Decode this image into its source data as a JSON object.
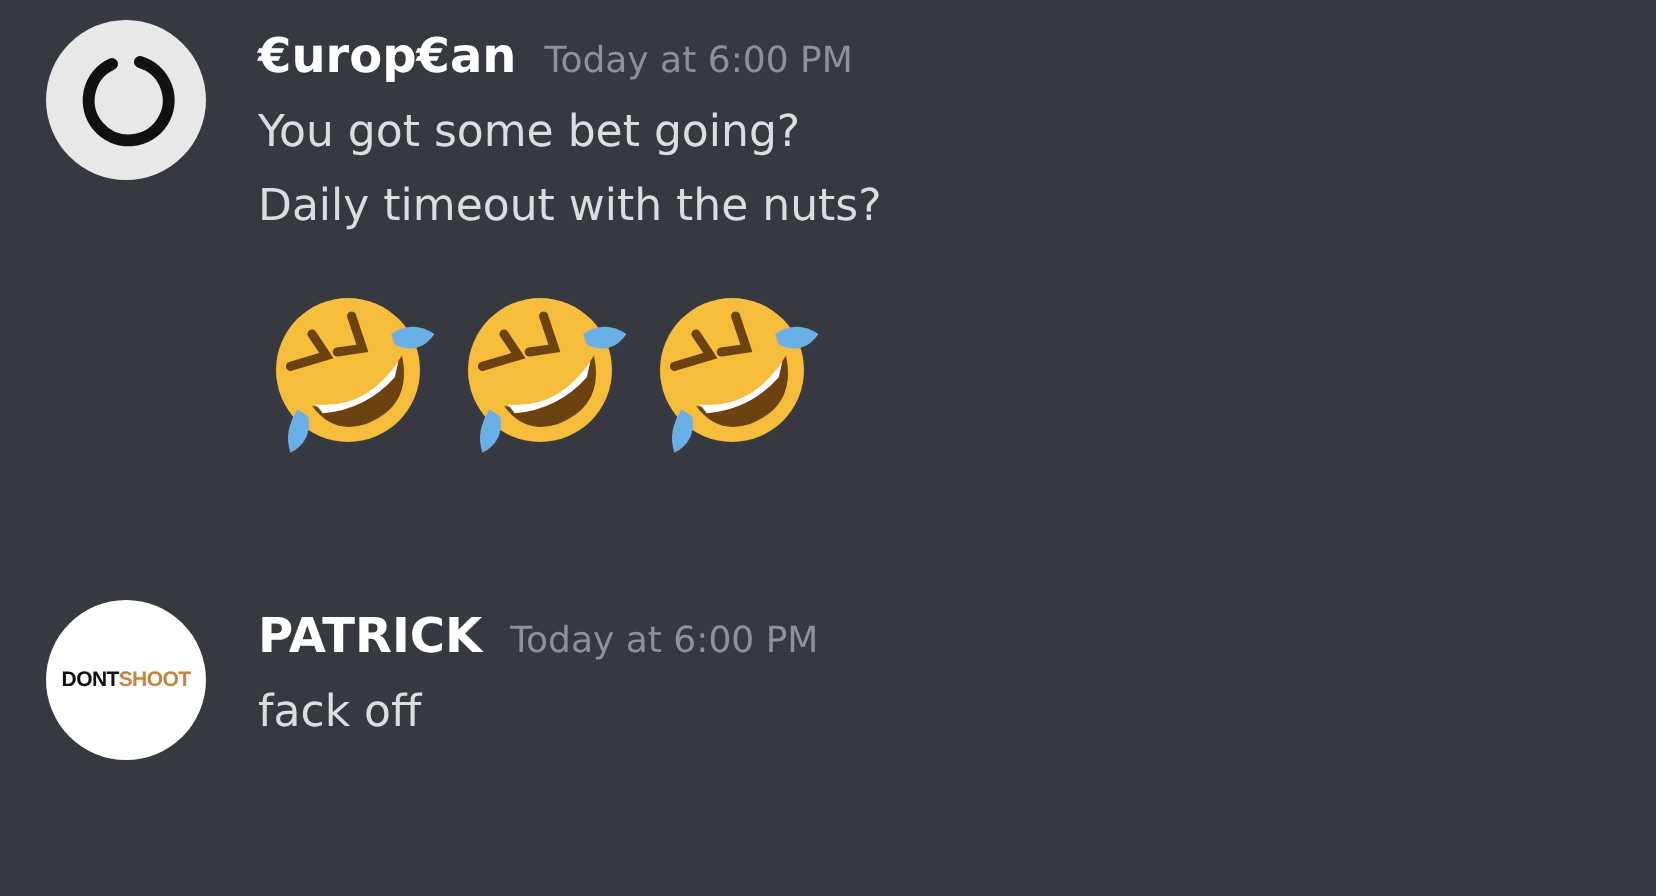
{
  "messages": [
    {
      "author": "€urop€an",
      "timestamp": "Today at 6:00 PM",
      "avatar": {
        "kind": "enso"
      },
      "lines": [
        {
          "kind": "text",
          "text": "You got some bet going?"
        },
        {
          "kind": "text",
          "text": "Daily timeout with the nuts?"
        },
        {
          "kind": "emojis",
          "emojis": [
            {
              "kind": "rofl"
            },
            {
              "kind": "rofl"
            },
            {
              "kind": "rofl"
            }
          ]
        }
      ]
    },
    {
      "author": "PATRICK",
      "timestamp": "Today at 6:00 PM",
      "avatar": {
        "kind": "logo",
        "dark": "DONT",
        "accent": "SHOOT"
      },
      "lines": [
        {
          "kind": "text",
          "text": "fack off"
        }
      ]
    }
  ]
}
